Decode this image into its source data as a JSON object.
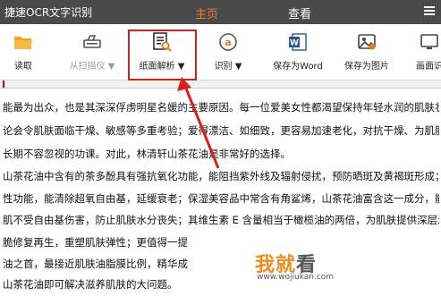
{
  "titlebar": {
    "app_title": "捷速OCR文字识别",
    "tabs": [
      {
        "label": "主页",
        "active": true
      },
      {
        "label": "查看",
        "active": false
      }
    ]
  },
  "toolbar": {
    "items": [
      {
        "label": "读取",
        "icon": "open-folder-icon",
        "disabled": false
      },
      {
        "label": "从扫描仪 ▼",
        "icon": "scanner-icon",
        "disabled": true
      },
      {
        "label": "纸面解析 ▼",
        "icon": "document-search-icon",
        "disabled": false
      },
      {
        "label": "识别 ▼",
        "icon": "recognize-icon",
        "disabled": false
      },
      {
        "label": "保存为Word",
        "icon": "word-icon",
        "disabled": false
      },
      {
        "label": "保存为图片",
        "icon": "image-icon",
        "disabled": false
      },
      {
        "label": "画面识",
        "icon": "screen-icon",
        "disabled": false
      }
    ]
  },
  "document": {
    "lines": [
      "能最为出众，也是其深深俘虏明星名媛的主要原因。每一位爱美女性都渴望保持年轻水润的肌肤状态",
      "论会令肌肤面临干燥、敏感等多重考验；爱得漂洁、如细致，更容易加速老化，对抗干燥、为肌肤补",
      "长期不容忽视的功课。对此，林清轩山茶花油是非常好的选择。",
      "山茶花油中含有的茶多酚具有强抗氧化功能，能阻挡紫外线及辐射侵扰，预防晒斑及黄褐斑形成；内含",
      "性功能，能清除超氧自由基，延缓衰老；保湿美容品中常含有角鲨烯，山茶花油富含这一成分，能有",
      "肌不受自由基伤害，防止肌肤水分丧失；其维生素 E 含量相当于橄榄油的两倍，为肌肤提供深层滋润",
      "脆修复再生，重塑肌肤弹性；更值得一提",
      "油之首，最接近肌肤油脂膜比例，精华成",
      "山茶花油即可解决滋养肌肤的大问题。"
    ]
  },
  "watermark": {
    "brand_main": "我就",
    "brand_tail": "看",
    "url": "www.wojiukan.com"
  },
  "colors": {
    "titlebar_bg": "#4a4a4a",
    "active_tab": "#f07a2a",
    "highlight": "#d62020",
    "watermark": "#f08b1c"
  }
}
